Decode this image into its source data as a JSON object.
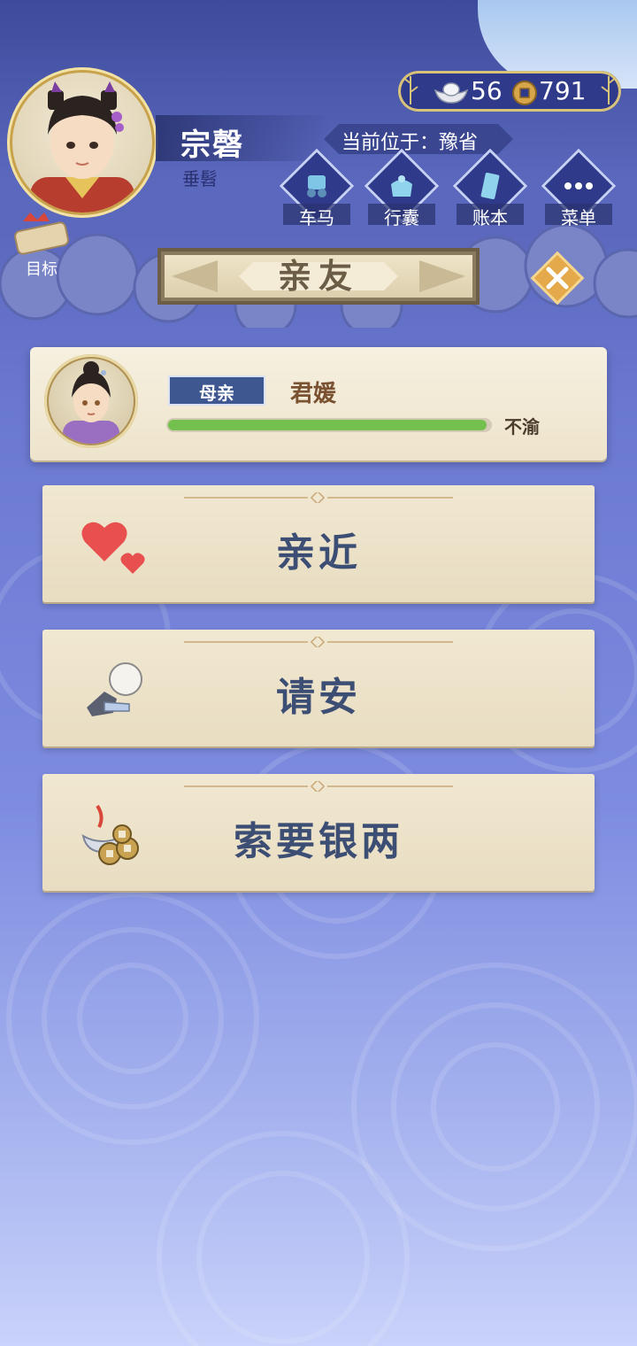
{
  "player": {
    "name": "宗磬",
    "title": "垂髫"
  },
  "currency": {
    "silver": "56",
    "coins": "791"
  },
  "location": "当前位于：豫省",
  "nav": [
    {
      "label": "车马",
      "icon": "carriage-icon"
    },
    {
      "label": "行囊",
      "icon": "bundle-icon"
    },
    {
      "label": "账本",
      "icon": "ledger-icon"
    },
    {
      "label": "菜单",
      "icon": "menu-dots-icon"
    }
  ],
  "goal": {
    "label": "目标"
  },
  "section": {
    "title": "亲友"
  },
  "relative": {
    "relation": "母亲",
    "name": "君媛",
    "mood": "不渝",
    "mood_level": 0.99
  },
  "actions": [
    {
      "label": "亲近",
      "icon": "hearts-icon"
    },
    {
      "label": "请安",
      "icon": "bowing-figure-icon"
    },
    {
      "label": "索要银两",
      "icon": "silver-coins-icon"
    }
  ],
  "colors": {
    "accent_gold": "#d8c37a",
    "navy": "#2f3b8a",
    "card_bg": "#f1e8d2",
    "action_text": "#3c4e74",
    "mood_bar": "#74c04e"
  }
}
